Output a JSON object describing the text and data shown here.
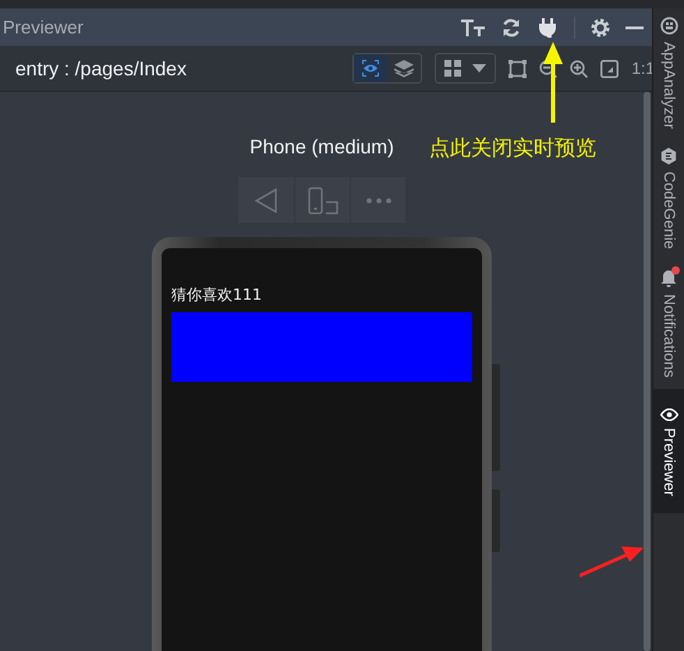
{
  "panel": {
    "title": "Previewer"
  },
  "toolbar": {
    "path": "entry : /pages/Index",
    "view_modes": [
      {
        "kind": "inspect",
        "selected": true
      },
      {
        "kind": "layers",
        "selected": false
      }
    ],
    "zoom_label": "1:1"
  },
  "device": {
    "name": "Phone (medium)"
  },
  "annotation": {
    "text": "点此关闭实时预览"
  },
  "app_screen": {
    "text": "猜你喜欢111"
  },
  "side_tabs": [
    {
      "kind": "analyzer",
      "label": "AppAnalyzer",
      "selected": false,
      "alert": false
    },
    {
      "kind": "genie",
      "label": "CodeGenie",
      "selected": false,
      "alert": false
    },
    {
      "kind": "bell",
      "label": "Notifications",
      "selected": false,
      "alert": true
    },
    {
      "kind": "eye",
      "label": "Previewer",
      "selected": true,
      "alert": false
    }
  ]
}
